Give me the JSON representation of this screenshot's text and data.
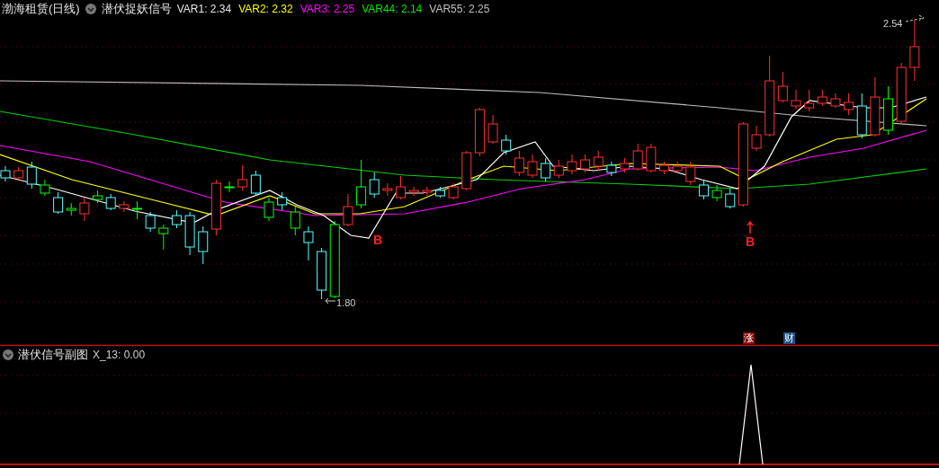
{
  "header": {
    "title": "渤海租赁(日线)",
    "indicator": "潜伏捉妖信号",
    "values": [
      {
        "text": "VAR1: 2.34",
        "color": "#e6e6e6"
      },
      {
        "text": "VAR2: 2.32",
        "color": "#ffff00"
      },
      {
        "text": "VAR3: 2.25",
        "color": "#ff00ff"
      },
      {
        "text": "VAR44: 2.14",
        "color": "#00e600"
      },
      {
        "text": "VAR55: 2.25",
        "color": "#c0c0c0"
      }
    ]
  },
  "main_chart": {
    "high_label": "2.54",
    "low_label": "1.80",
    "signals": [
      {
        "text": "B",
        "arrow": false
      },
      {
        "text": "B",
        "arrow": true
      }
    ],
    "badges": [
      {
        "text": "涨",
        "color": "#8b0a0a"
      },
      {
        "text": "财",
        "color": "#1b4f86"
      }
    ]
  },
  "sub_panel": {
    "title": "潜伏信号副图",
    "values": [
      {
        "text": "X_13: 0.00",
        "color": "#d0d0d0"
      }
    ]
  }
}
